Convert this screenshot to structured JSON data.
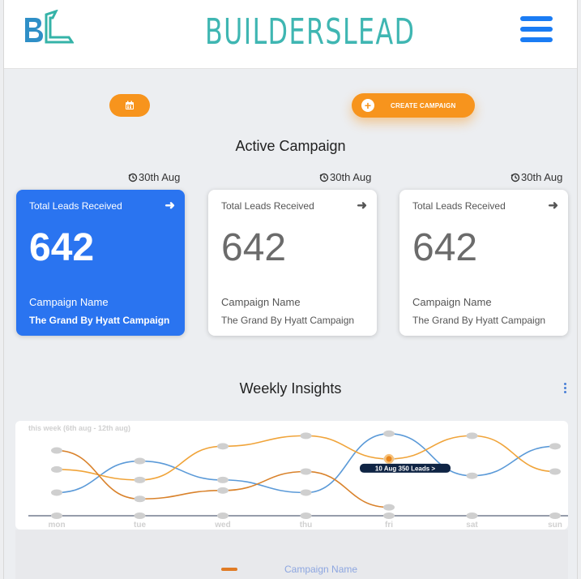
{
  "header": {
    "logo_text": "BL",
    "brand": "BUILDERSLEAD",
    "menu_icon": "hamburger-icon"
  },
  "toolbar": {
    "calendar_icon": "calendar-icon",
    "create_label": "CREATE CAMPAIGN",
    "create_icon": "plus-circle-icon"
  },
  "active": {
    "title": "Active Campaign",
    "cards": [
      {
        "date": "30th Aug",
        "heading": "Total Leads Received",
        "count": "642",
        "name_label": "Campaign Name",
        "name": "The Grand By Hyatt Campaign",
        "selected": true
      },
      {
        "date": "30th Aug",
        "heading": "Total Leads Received",
        "count": "642",
        "name_label": "Campaign Name",
        "name": "The Grand By Hyatt Campaign",
        "selected": false
      },
      {
        "date": "30th Aug",
        "heading": "Total Leads Received",
        "count": "642",
        "name_label": "Campaign Name",
        "name": "The Grand By Hyatt Campaign",
        "selected": false
      }
    ]
  },
  "insights": {
    "title": "Weekly Insights",
    "menu_icon": "more-vertical-icon",
    "legend_label": "Campaign Name",
    "colors": {
      "blue": "#5b9ad8",
      "orange": "#f0a43a",
      "brown": "#d9822b",
      "axis": "#2d3a57"
    }
  },
  "chart_data": {
    "type": "line",
    "subtitle": "this week (6th aug - 12th aug)",
    "categories": [
      "mon",
      "tue",
      "wed",
      "thu",
      "fri",
      "sat",
      "sun"
    ],
    "ylim": [
      0,
      420
    ],
    "series": [
      {
        "color": "#5b9ad8",
        "values": [
          110,
          260,
          170,
          110,
          390,
          190,
          330
        ]
      },
      {
        "color": "#f0a43a",
        "values": [
          220,
          170,
          330,
          380,
          270,
          380,
          210
        ]
      },
      {
        "color": "#d9822b",
        "values": [
          310,
          80,
          120,
          210,
          40,
          null,
          null
        ]
      }
    ],
    "tooltip": {
      "text": "10 Aug 350 Leads >",
      "category": "fri",
      "value": 270
    }
  }
}
